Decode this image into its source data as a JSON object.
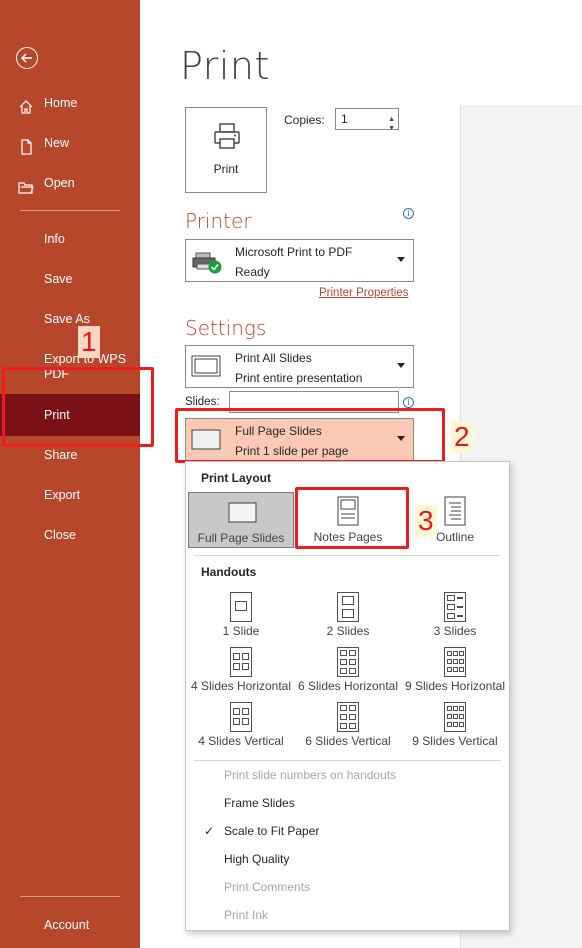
{
  "sidebar": {
    "items": [
      {
        "label": "Home"
      },
      {
        "label": "New"
      },
      {
        "label": "Open"
      },
      {
        "label": "Info"
      },
      {
        "label": "Save"
      },
      {
        "label": "Save As"
      },
      {
        "label": "Export to WPS PDF"
      },
      {
        "label": "Print"
      },
      {
        "label": "Share"
      },
      {
        "label": "Export"
      },
      {
        "label": "Close"
      },
      {
        "label": "Account"
      }
    ],
    "accent_color": "#b7472a",
    "selected_color": "#7b1016"
  },
  "main": {
    "title": "Print",
    "print_button_label": "Print",
    "copies_label": "Copies:",
    "copies_value": "1",
    "printer_heading": "Printer",
    "printer_name": "Microsoft Print to PDF",
    "printer_status": "Ready",
    "printer_properties_link": "Printer Properties",
    "settings_heading": "Settings",
    "range_title": "Print All Slides",
    "range_subtitle": "Print entire presentation",
    "slides_label": "Slides:",
    "layout_title": "Full Page Slides",
    "layout_subtitle": "Print 1 slide per page"
  },
  "annotations": {
    "n1": "1",
    "n2": "2",
    "n3": "3",
    "highlight_color": "#ee1c1c"
  },
  "layout_menu": {
    "print_layout_heading": "Print Layout",
    "layout_options": [
      {
        "label": "Full Page Slides",
        "selected": true
      },
      {
        "label": "Notes Pages",
        "selected": false
      },
      {
        "label": "Outline",
        "selected": false
      }
    ],
    "handouts_heading": "Handouts",
    "handouts": [
      {
        "label": "1 Slide"
      },
      {
        "label": "2 Slides"
      },
      {
        "label": "3 Slides"
      },
      {
        "label": "4 Slides Horizontal"
      },
      {
        "label": "6 Slides Horizontal"
      },
      {
        "label": "9 Slides Horizontal"
      },
      {
        "label": "4 Slides Vertical"
      },
      {
        "label": "6 Slides Vertical"
      },
      {
        "label": "9 Slides Vertical"
      }
    ],
    "options": [
      {
        "label": "Print slide numbers on handouts",
        "enabled": false,
        "checked": false
      },
      {
        "label": "Frame Slides",
        "enabled": true,
        "checked": false
      },
      {
        "label": "Scale to Fit Paper",
        "enabled": true,
        "checked": true
      },
      {
        "label": "High Quality",
        "enabled": true,
        "checked": false
      },
      {
        "label": "Print Comments",
        "enabled": false,
        "checked": false
      },
      {
        "label": "Print Ink",
        "enabled": false,
        "checked": false
      }
    ],
    "check_glyph": "✓"
  }
}
